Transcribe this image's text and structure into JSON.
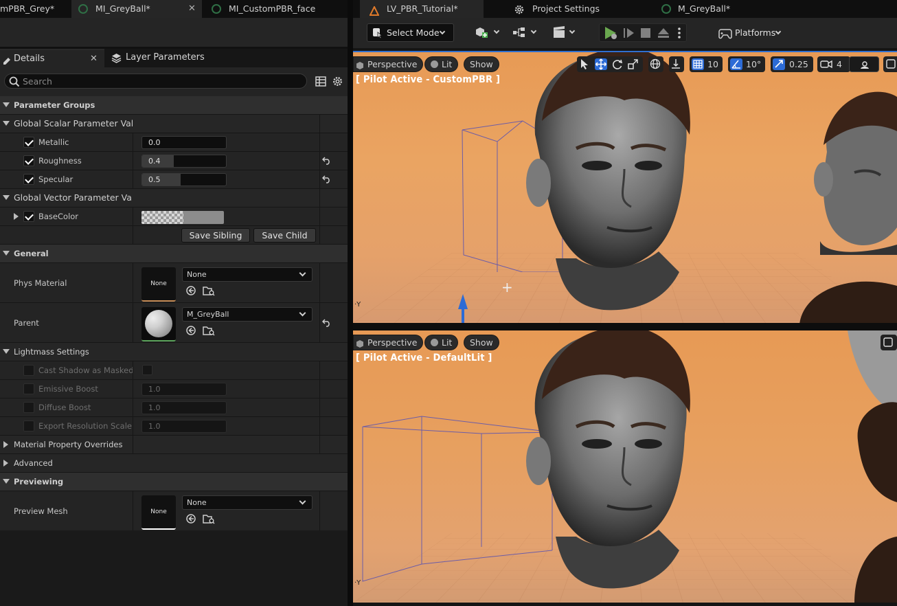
{
  "left_tabs": [
    {
      "label": "mPBR_Grey*"
    },
    {
      "label": "MI_GreyBall*"
    },
    {
      "label": "MI_CustomPBR_face"
    }
  ],
  "details_tabs": [
    {
      "label": "Details"
    },
    {
      "label": "Layer Parameters"
    }
  ],
  "search": {
    "placeholder": "Search",
    "value": ""
  },
  "sections": {
    "parameter_groups": "Parameter Groups",
    "global_scalar": "Global Scalar Parameter Value",
    "global_vector": "Global Vector Parameter Value",
    "general": "General",
    "lightmass": "Lightmass Settings",
    "material_overrides": "Material Property Overrides",
    "advanced": "Advanced",
    "previewing": "Previewing"
  },
  "scalar_params": [
    {
      "label": "Metallic",
      "value": "0.0",
      "fraction": 0.0,
      "checked": true,
      "reset": false
    },
    {
      "label": "Roughness",
      "value": "0.4",
      "fraction": 0.4,
      "checked": true,
      "reset": true
    },
    {
      "label": "Specular",
      "value": "0.5",
      "fraction": 0.5,
      "checked": true,
      "reset": true
    }
  ],
  "vector_params": [
    {
      "label": "BaseColor",
      "checked": true
    }
  ],
  "buttons": {
    "save_sibling": "Save Sibling",
    "save_child": "Save Child"
  },
  "general": {
    "phys_material": {
      "label": "Phys Material",
      "thumb": "None",
      "value": "None"
    },
    "parent": {
      "label": "Parent",
      "value": "M_GreyBall"
    }
  },
  "lightmass": [
    {
      "label": "Cast Shadow as Masked",
      "value": null
    },
    {
      "label": "Emissive Boost",
      "value": "1.0"
    },
    {
      "label": "Diffuse Boost",
      "value": "1.0"
    },
    {
      "label": "Export Resolution Scale",
      "value": "1.0"
    }
  ],
  "previewing": {
    "preview_mesh": {
      "label": "Preview Mesh",
      "thumb": "None",
      "value": "None"
    }
  },
  "right_tabs": [
    {
      "label": "LV_PBR_Tutorial*"
    },
    {
      "label": "Project Settings"
    },
    {
      "label": "M_GreyBall*"
    }
  ],
  "toolbar": {
    "select_mode": "Select Mode",
    "platforms": "Platforms"
  },
  "viewport_top": {
    "perspective": "Perspective",
    "lit": "Lit",
    "show": "Show",
    "pilot": "[ Pilot Active - CustomPBR ]",
    "grid_snap": "10",
    "rot_snap": "10°",
    "scale_snap": "0.25",
    "camera_speed": "4"
  },
  "viewport_bottom": {
    "perspective": "Perspective",
    "lit": "Lit",
    "show": "Show",
    "pilot": "[ Pilot Active - DefaultLit ]"
  },
  "colors": {
    "accent_blue": "#2f6fd0",
    "sky_orange": "#e79a55",
    "panel": "#242424"
  }
}
